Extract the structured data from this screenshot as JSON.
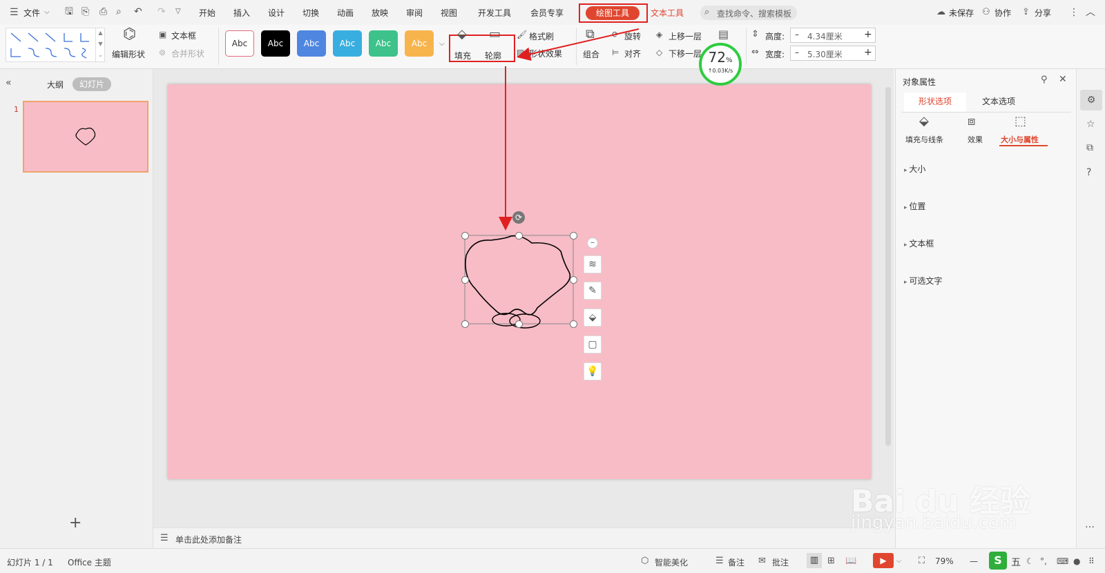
{
  "menubar": {
    "file_label": "文件",
    "tabs": [
      "开始",
      "插入",
      "设计",
      "切换",
      "动画",
      "放映",
      "审阅",
      "视图",
      "开发工具",
      "会员专享"
    ],
    "drawing_tools": "绘图工具",
    "text_tools": "文本工具",
    "search_placeholder": "查找命令、搜索模板",
    "unsaved": "未保存",
    "collab": "协作",
    "share": "分享"
  },
  "ribbon": {
    "edit_shape": "编辑形状",
    "textbox": "文本框",
    "merge_shape": "合并形状",
    "style_sample": "Abc",
    "fill": "填充",
    "outline": "轮廓",
    "format_brush": "格式刷",
    "shape_effects": "形状效果",
    "rotate": "旋转",
    "bring_forward": "上移一层",
    "group": "组合",
    "align": "对齐",
    "send_backward": "下移一层",
    "height_label": "高度:",
    "height_value": "4.34厘米",
    "width_label": "宽度:",
    "width_value": "5.30厘米",
    "perf_value": "72",
    "perf_unit": "%",
    "perf_speed": "↑0.03K/s"
  },
  "left_panel": {
    "outline_tab": "大纲",
    "slides_tab": "幻灯片",
    "slide_number": "1"
  },
  "notes_placeholder": "单击此处添加备注",
  "right_panel": {
    "title": "对象属性",
    "tab_shape": "形状选项",
    "tab_text": "文本选项",
    "sub_fill": "填充与线条",
    "sub_effects": "效果",
    "sub_size": "大小与属性",
    "sections": [
      "大小",
      "位置",
      "文本框",
      "可选文字"
    ]
  },
  "status": {
    "slide_info": "幻灯片 1 / 1",
    "theme": "Office 主题",
    "smart": "智能美化",
    "notes": "备注",
    "comments": "批注",
    "zoom": "79%",
    "ime": "五"
  },
  "watermark": {
    "brand": "Bai du 经验",
    "url": "jingyan.baidu.com"
  },
  "colors": {
    "accent": "#e0462f",
    "highlight": "#e02020",
    "slide_bg": "#f7bcc6",
    "perf_ring": "#2ecc40"
  }
}
